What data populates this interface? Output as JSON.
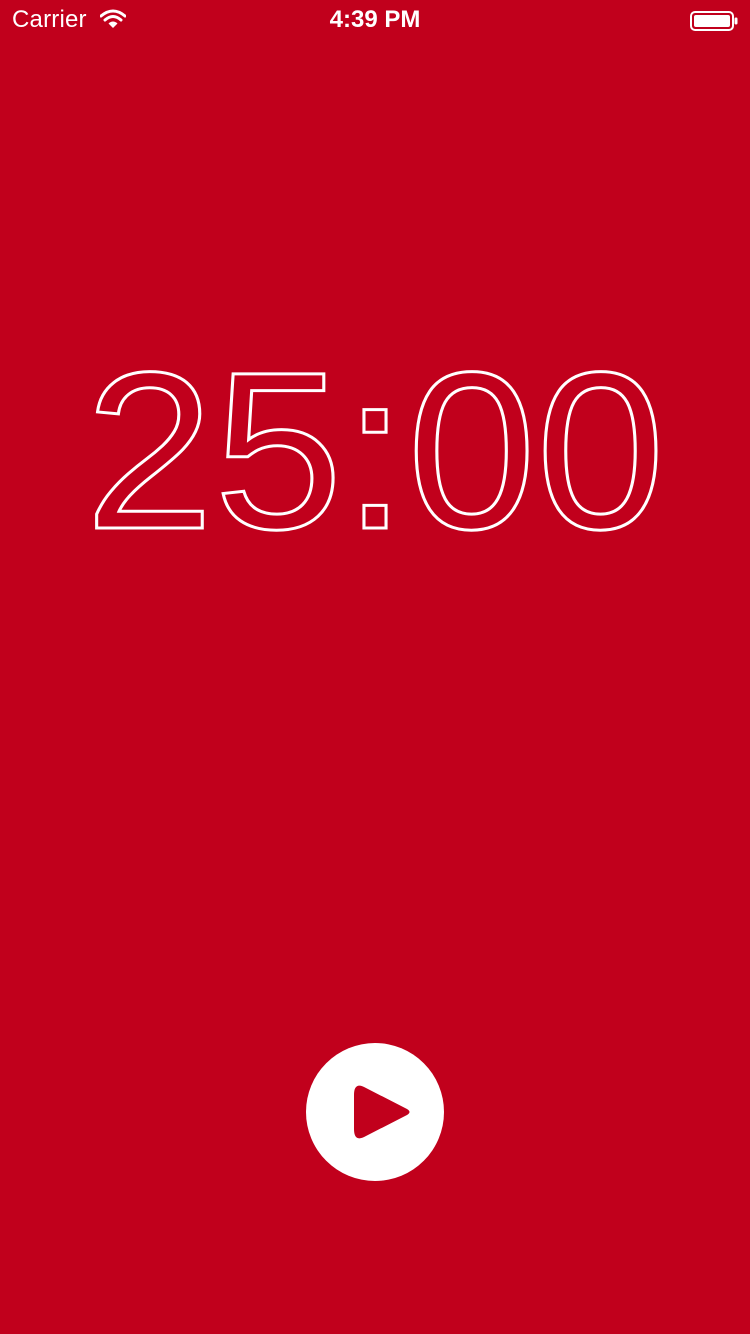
{
  "status_bar": {
    "carrier": "Carrier",
    "time": "4:39 PM",
    "wifi_icon": "wifi-icon",
    "battery_icon": "battery-icon"
  },
  "timer": {
    "display": "25:00"
  },
  "controls": {
    "play_icon": "play-icon"
  },
  "colors": {
    "background": "#C1001C",
    "foreground": "#FFFFFF"
  }
}
